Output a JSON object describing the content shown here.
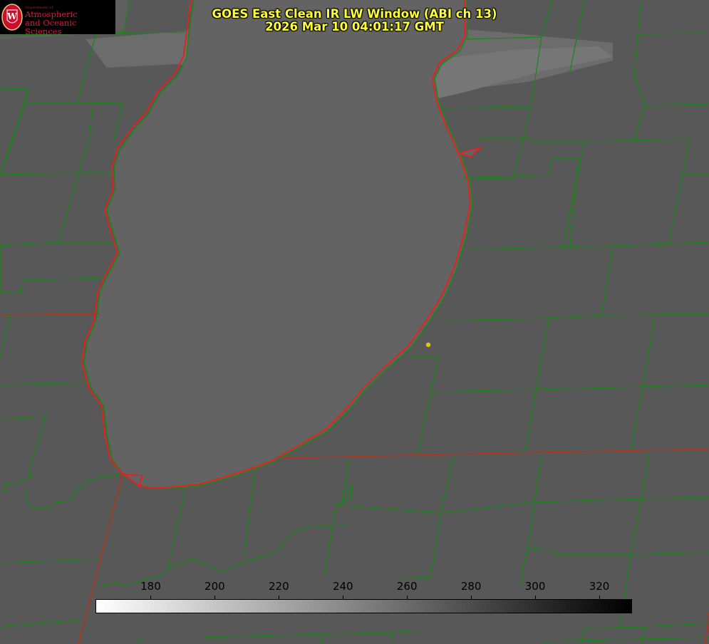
{
  "title": {
    "line1": "GOES East Clean IR LW Window (ABI ch 13)",
    "line2": "2026 Mar 10 04:01:17 GMT"
  },
  "logo": {
    "department": "Department of",
    "line1": "Atmospheric",
    "line2": "and Oceanic Sciences",
    "seal_letter": "W",
    "color": "#c8102e"
  },
  "colorbar": {
    "min": 163,
    "max": 330,
    "ticks": [
      "180",
      "200",
      "220",
      "240",
      "260",
      "280",
      "300",
      "320"
    ],
    "tick_values": [
      180,
      200,
      220,
      240,
      260,
      280,
      300,
      320
    ],
    "gradient": [
      "#ffffff",
      "#000000"
    ]
  },
  "colors": {
    "background": "#5a5a5a",
    "lake": "#636363",
    "shoreline": "#ee1c1c",
    "county_lines": "#138a13",
    "state_lines": "#b2321a",
    "point_marker": "#d6c81a",
    "title_text": "#ffff33"
  },
  "icons": {
    "seal": "uw-crest-icon",
    "marker": "city-point-icon"
  }
}
